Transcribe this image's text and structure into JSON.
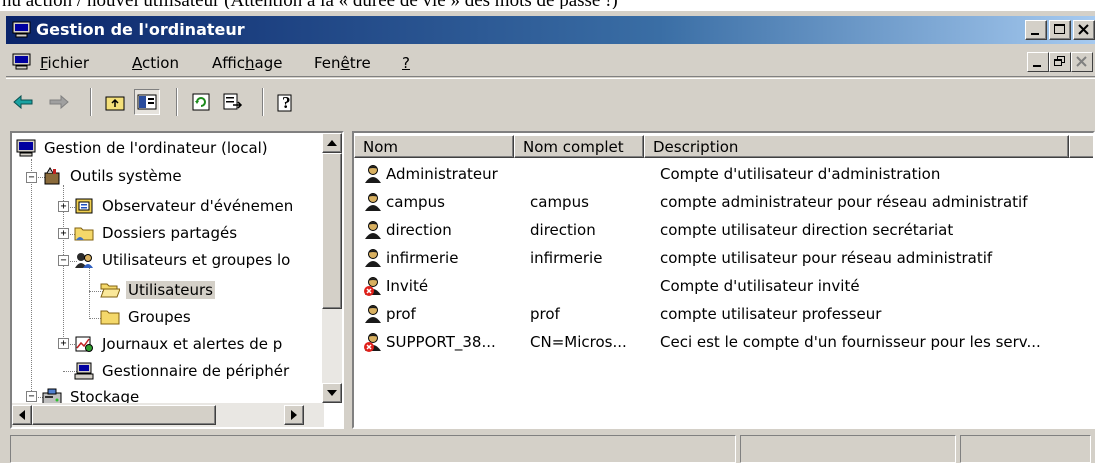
{
  "caption": "nu action / nouvel utilisateur (Attention à la « durée de vie » des mots de passe !)",
  "window": {
    "title": "Gestion de l'ordinateur",
    "icon": "computer-management-icon"
  },
  "menu": {
    "items": [
      {
        "label": "Fichier",
        "ul": "F"
      },
      {
        "label": "Action",
        "ul": "A"
      },
      {
        "label": "Affichage",
        "ul": "h"
      },
      {
        "label": "Fenêtre",
        "ul": "ê"
      },
      {
        "label": "?",
        "ul": "?"
      }
    ]
  },
  "toolbar": {
    "buttons": [
      "back-arrow-icon",
      "forward-arrow-icon",
      "up-folder-icon",
      "show-hide-tree-icon",
      "refresh-icon",
      "export-list-icon",
      "help-icon"
    ]
  },
  "tree": {
    "root": "Gestion de l'ordinateur (local)",
    "system_tools": "Outils système",
    "event_viewer": "Observateur d'événemen",
    "shared_folders": "Dossiers partagés",
    "local_users": "Utilisateurs et groupes lo",
    "users": "Utilisateurs",
    "groups": "Groupes",
    "perf_logs": "Journaux et alertes de p",
    "device_manager": "Gestionnaire de périphér",
    "storage": "Stockage"
  },
  "list": {
    "columns": [
      "Nom",
      "Nom complet",
      "Description"
    ],
    "rows": [
      {
        "name": "Administrateur",
        "full": "",
        "desc": "Compte d'utilisateur d'administration",
        "disabled": false
      },
      {
        "name": "campus",
        "full": "campus",
        "desc": "compte administrateur pour réseau administratif",
        "disabled": false
      },
      {
        "name": "direction",
        "full": "direction",
        "desc": "compte utilisateur direction secrétariat",
        "disabled": false
      },
      {
        "name": "infirmerie",
        "full": "infirmerie",
        "desc": "compte utilisateur pour réseau administratif",
        "disabled": false
      },
      {
        "name": "Invité",
        "full": "",
        "desc": "Compte d'utilisateur invité",
        "disabled": true
      },
      {
        "name": "prof",
        "full": "prof",
        "desc": "compte utilisateur professeur",
        "disabled": false
      },
      {
        "name": "SUPPORT_38...",
        "full": "CN=Micros...",
        "desc": "Ceci est le compte d'un fournisseur pour les serv...",
        "disabled": true
      }
    ]
  },
  "colors": {
    "title_start": "#0a246a",
    "title_end": "#a6caf0",
    "face": "#d4d0c8",
    "disabled_x": "#e0201a"
  }
}
